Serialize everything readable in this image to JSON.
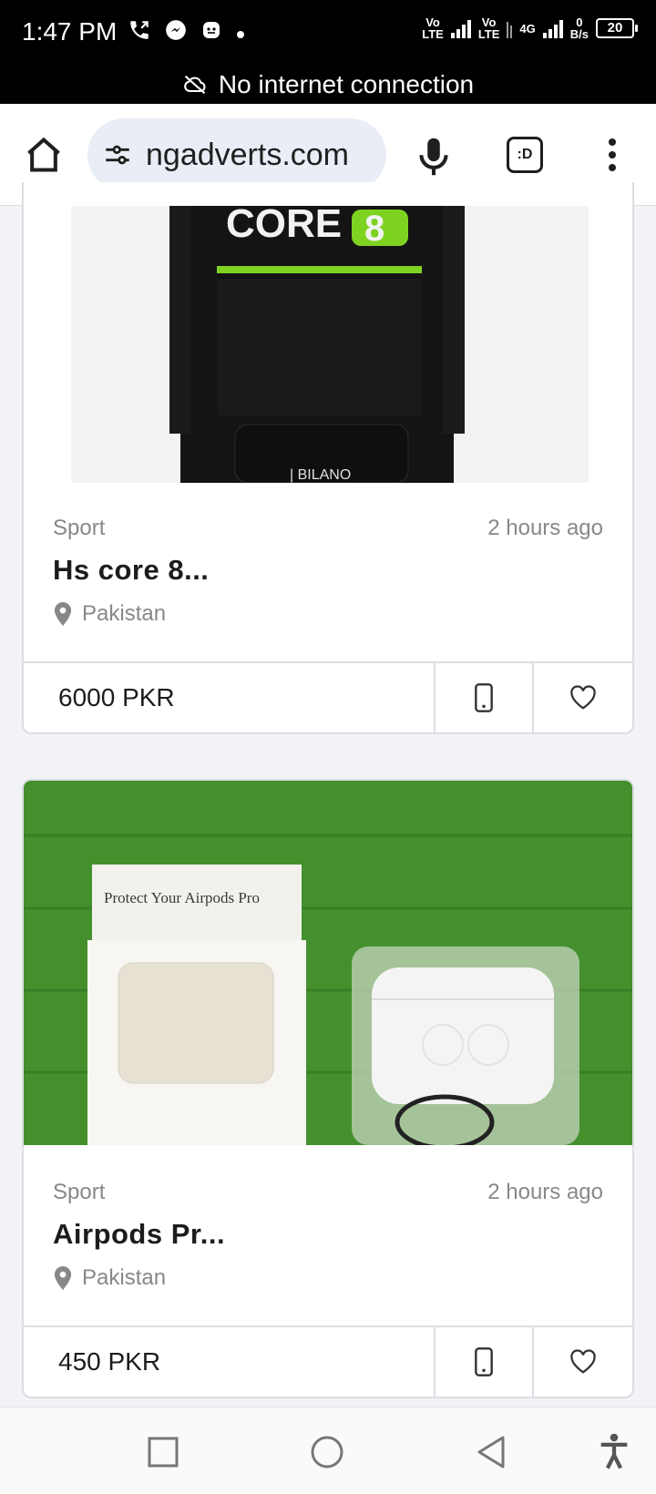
{
  "status_bar": {
    "time": "1:47 PM",
    "net1": "Vo",
    "net1_sub": "LTE",
    "net2": "Vo",
    "net2_sub": "LTE",
    "net3": "4G",
    "speed": "0",
    "speed_unit": "B/s",
    "battery": "20",
    "icons": [
      "phone-call-icon",
      "messenger-icon",
      "app-notification-icon",
      "dot-icon"
    ]
  },
  "offline_banner": {
    "text": "No internet connection",
    "icon": "cloud-off-icon"
  },
  "browser": {
    "url": "ngadverts.com",
    "tabs_label": ":D",
    "icons": [
      "home-icon",
      "site-settings-icon",
      "mic-icon",
      "tabs-icon",
      "overflow-menu-icon"
    ]
  },
  "listings": [
    {
      "category": "Sport",
      "time_ago": "2 hours ago",
      "title": "Hs core 8...",
      "location": "Pakistan",
      "price": "6000 PKR",
      "image_text": "CORE",
      "image_text_2": "8",
      "image_brand": "| BILANO"
    },
    {
      "category": "Sport",
      "time_ago": "2 hours ago",
      "title": "Airpods Pr...",
      "location": "Pakistan",
      "price": "450 PKR",
      "image_text": "Protect Your Airpods Pro"
    }
  ],
  "nav_bar": {
    "icons": [
      "recents-icon",
      "home-circle-icon",
      "back-icon",
      "accessibility-icon"
    ]
  },
  "colors": {
    "accent_green": "#7ed321",
    "grass": "#3f8a2a",
    "card_border": "#dcdde2",
    "muted_text": "#888888"
  }
}
